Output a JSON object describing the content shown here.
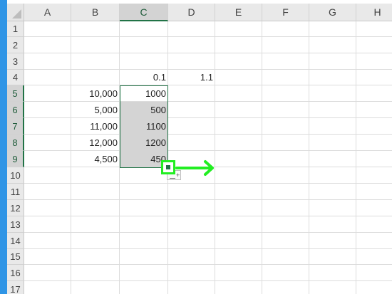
{
  "columns": [
    "A",
    "B",
    "C",
    "D",
    "E",
    "F",
    "G",
    "H"
  ],
  "rows": [
    "1",
    "2",
    "3",
    "4",
    "5",
    "6",
    "7",
    "8",
    "9",
    "10",
    "11",
    "12",
    "13",
    "14",
    "15",
    "16",
    "17"
  ],
  "cells": {
    "C4": "0.1",
    "D4": "1.1",
    "B5": "10,000",
    "C5": "1000",
    "B6": "5,000",
    "C6": "500",
    "B7": "11,000",
    "C7": "1100",
    "B8": "12,000",
    "C8": "1200",
    "B9": "4,500",
    "C9": "450"
  },
  "selection": {
    "range": "C5:C9"
  },
  "colors": {
    "selection_border": "#217346",
    "annotation_green": "#22ee22",
    "screen_edge_blue": "#2f95e6"
  },
  "icons": {
    "fill_handle": "fill-handle-icon",
    "arrow": "arrow-right-icon",
    "autofill_options": "autofill-options-icon"
  }
}
